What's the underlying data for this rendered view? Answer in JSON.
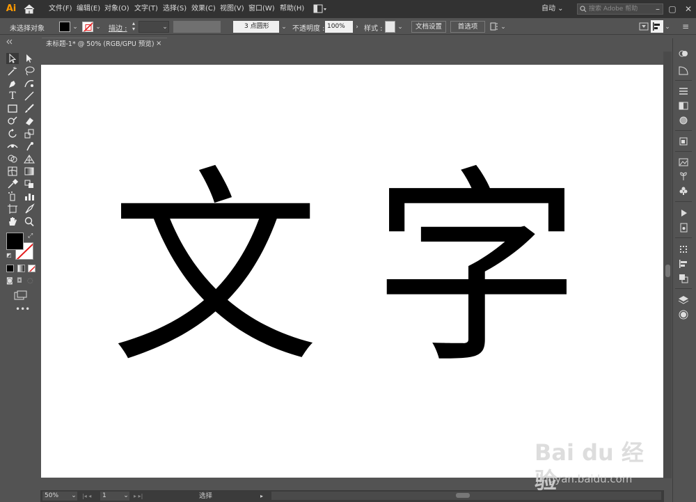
{
  "app": {
    "logo_text": "Ai"
  },
  "menu": [
    "文件(F)",
    "编辑(E)",
    "对象(O)",
    "文字(T)",
    "选择(S)",
    "效果(C)",
    "视图(V)",
    "窗口(W)",
    "帮助(H)"
  ],
  "workspace": {
    "label": "自动 ⌄"
  },
  "search": {
    "placeholder": "搜索 Adobe 帮助"
  },
  "control_bar": {
    "selection_state": "未选择对象",
    "stroke_label": "描边 :",
    "brush_definition": "3 点圆形",
    "opacity_label": "不透明度 :",
    "opacity_value": "100%",
    "style_label": "样式 :",
    "document_setup": "文档设置",
    "preferences": "首选项"
  },
  "document": {
    "tab_title": "未标题-1* @ 50% (RGB/GPU 预览)",
    "close_glyph": "×",
    "artboard_text": [
      "文",
      "字"
    ]
  },
  "status_bar": {
    "zoom": "50%",
    "artboard_number": "1",
    "current_tool": "选择"
  },
  "watermark": {
    "logo": "Bai du 经验",
    "url": "jingyan.baidu.com"
  },
  "colors": {
    "accent": "#ff9a00",
    "menubar_bg": "#323232",
    "panel_bg": "#535353",
    "artboard_bg": "#ffffff",
    "fill_color": "#000000",
    "stroke_color": "none"
  }
}
